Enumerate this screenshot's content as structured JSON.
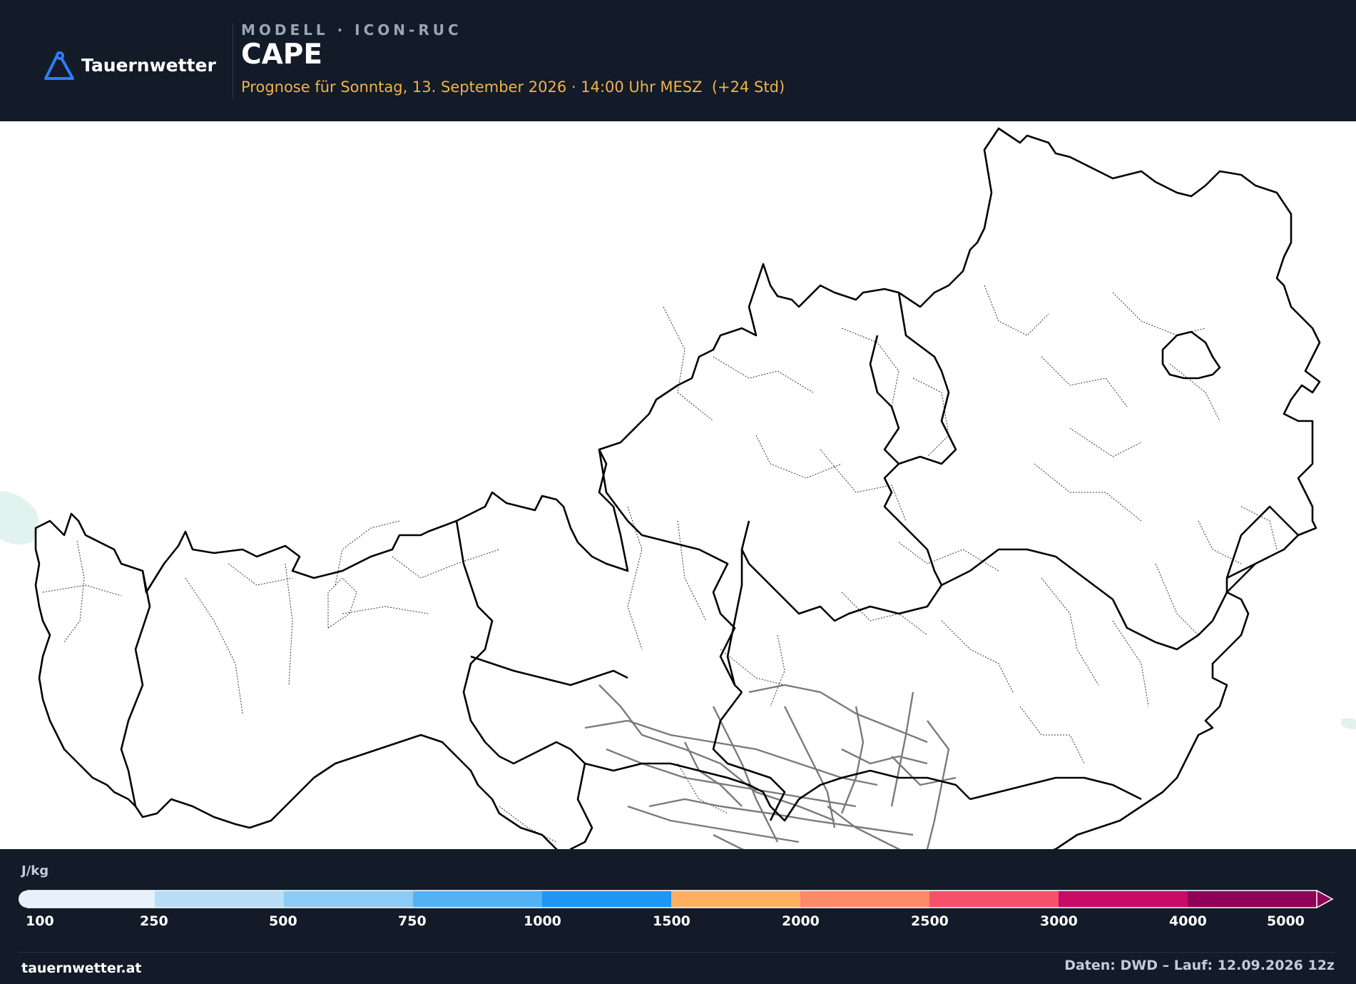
{
  "header": {
    "logo_text": "Tauernwetter",
    "model_label": "MODELL · ICON-RUC",
    "title": "CAPE",
    "subtitle": "Prognose für Sonntag, 13. September 2026 · 14:00 Uhr MESZ  (+24 Std)"
  },
  "legend": {
    "unit": "J/kg",
    "ticks": [
      "100",
      "250",
      "500",
      "750",
      "1000",
      "1500",
      "2000",
      "2500",
      "3000",
      "4000",
      "5000"
    ],
    "colors": [
      "#e6f1fb",
      "#b8ddf8",
      "#8ccbf6",
      "#56b1f4",
      "#1f95f5",
      "#fdae61",
      "#fc8a68",
      "#f6516a",
      "#c90b67",
      "#8f0058"
    ]
  },
  "footer": {
    "left": "tauernwetter.at",
    "right": "Daten: DWD – Lauf: 12.09.2026 12z"
  },
  "map": {
    "region": "Österreich",
    "background": "#ffffff"
  },
  "icons": {
    "logo": "mountain-pin-icon"
  }
}
